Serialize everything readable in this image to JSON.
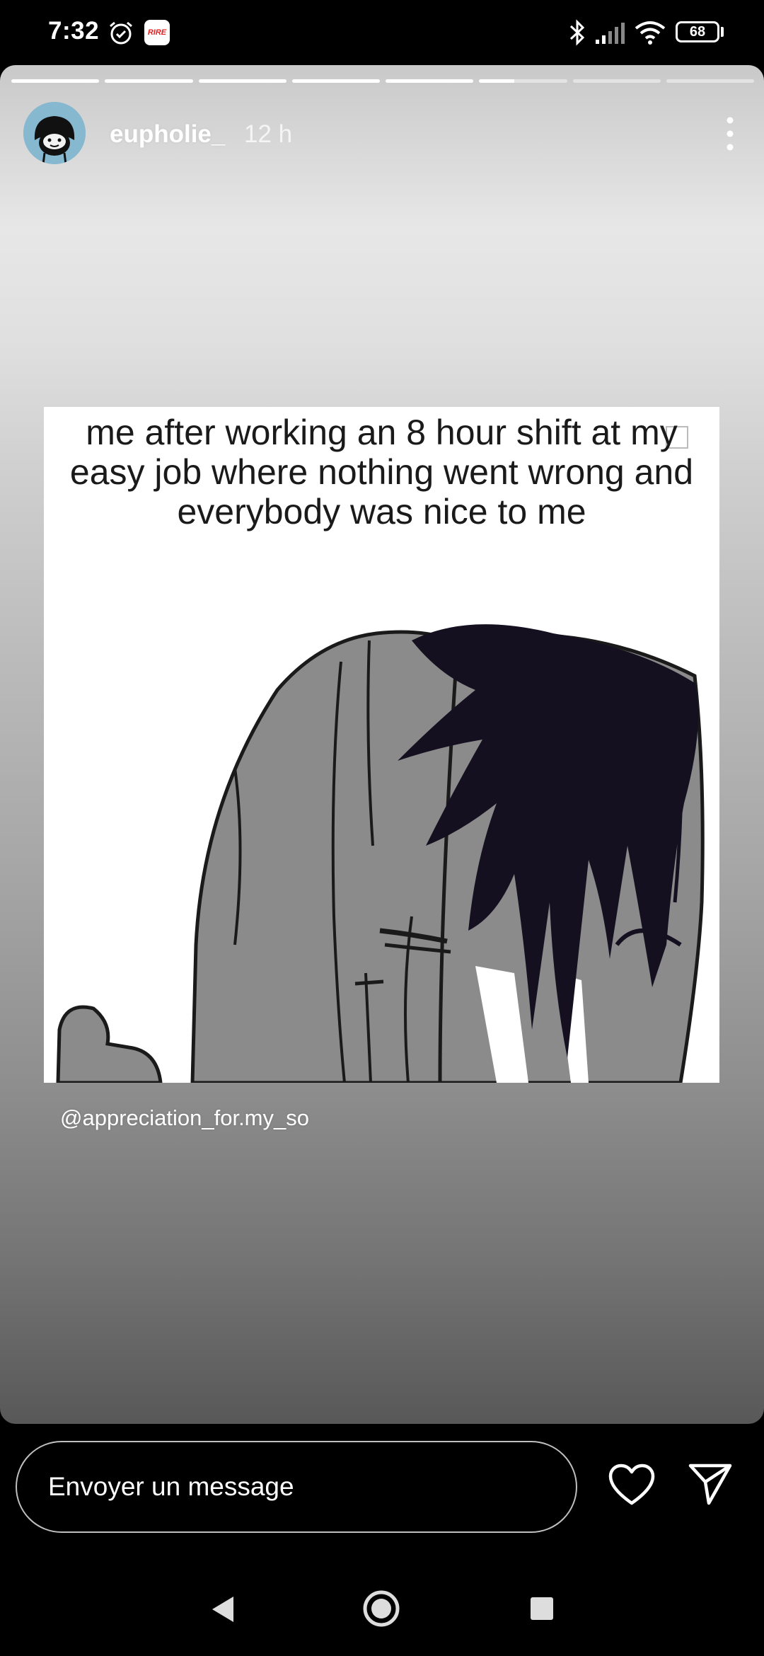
{
  "status_bar": {
    "time": "7:32",
    "app_badge": "RIRE",
    "battery": "68",
    "icons": [
      "alarm-icon",
      "app-badge",
      "bluetooth-icon",
      "signal-icon",
      "wifi-icon",
      "battery-icon"
    ]
  },
  "story": {
    "progress": {
      "segments": 8,
      "completed": 5,
      "current_fraction": 0.4
    },
    "username": "eupholie_",
    "time_ago": "12 h",
    "meme_caption": "me after working an 8 hour shift at my easy job where nothing went wrong and everybody was nice to me",
    "mention": "@appreciation_for.my_so",
    "icons": [
      "more-options-icon",
      "avatar"
    ]
  },
  "reply_bar": {
    "placeholder": "Envoyer un message",
    "icons": [
      "heart-icon",
      "send-icon"
    ]
  },
  "nav_bar": {
    "icons": [
      "back-icon",
      "home-icon",
      "recents-icon"
    ]
  }
}
